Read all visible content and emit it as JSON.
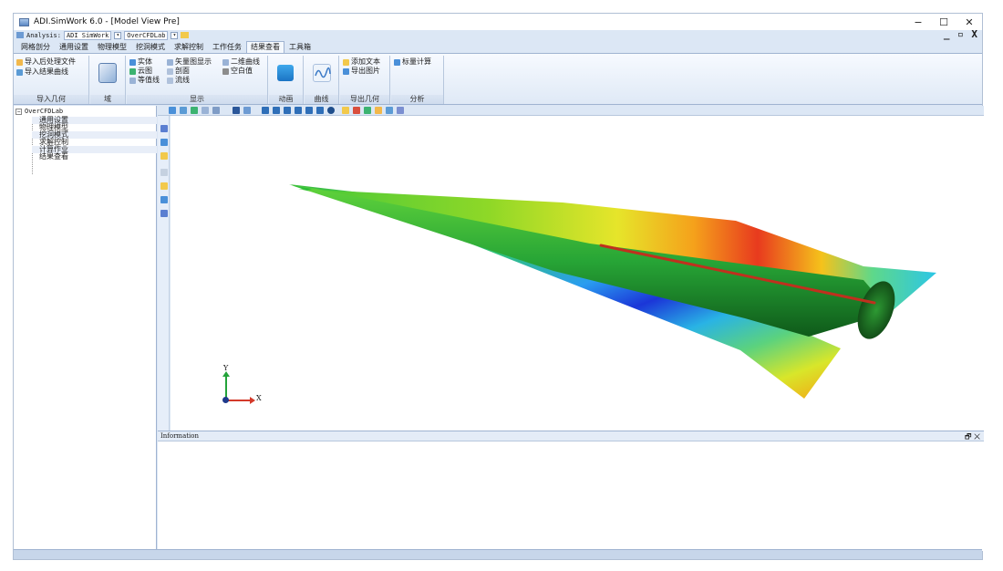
{
  "window": {
    "title": "ADI.SimWork 6.0 - [Model View Pre]",
    "minimize": "−",
    "maximize": "☐",
    "close": "✕"
  },
  "toolbar2": {
    "analysis_label": "Analysis:",
    "analysis_value": "ADI SimWork",
    "project_value": "OverCFDLab",
    "mdi_controls": "_ ▫ X"
  },
  "tabs": [
    "网格剖分",
    "通用设置",
    "物理模型",
    "挖洞模式",
    "求解控制",
    "工作任务",
    "结果查看",
    "工具箱"
  ],
  "active_tab": "结果查看",
  "ribbon": {
    "import": {
      "items": [
        "导入后处理文件",
        "导入结果曲线"
      ],
      "label": "导入几何"
    },
    "domain": {
      "label": "域"
    },
    "display": {
      "items": [
        "实体",
        "云图",
        "等值线",
        "矢量图显示",
        "剖面",
        "流线",
        "二维曲线",
        "空白值"
      ],
      "label": "显示"
    },
    "animation": {
      "label": "动画"
    },
    "curve": {
      "label": "曲线"
    },
    "export": {
      "items": [
        "添加文本",
        "导出图片"
      ],
      "label": "导出几何"
    },
    "analysis": {
      "items": [
        "标量计算"
      ],
      "label": "分析"
    }
  },
  "tree": {
    "root": "OverCFDLab",
    "items": [
      "通用设置",
      "物理模型",
      "挖洞模式",
      "求解控制",
      "计算作业",
      "结果查看"
    ]
  },
  "axes": {
    "y": "Y",
    "x": "X"
  },
  "info_panel": {
    "title": "Information",
    "controls": "🗗 ✕"
  },
  "colors": {
    "accent": "#2b579a",
    "ribbon_bg": "#dfe9f6",
    "panel_border": "#9fb3d1"
  },
  "icons": [
    "fit-view-icon",
    "zoom-icon",
    "rotate-icon",
    "pan-icon",
    "axis-icon",
    "select-icon",
    "cube-view-icon",
    "sphere-icon",
    "triad-icon",
    "folder-icon",
    "grid-icon"
  ]
}
